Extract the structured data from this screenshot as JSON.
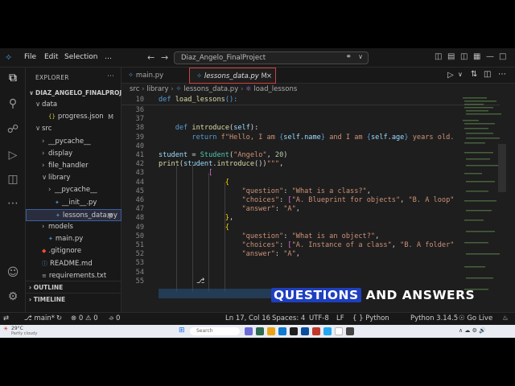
{
  "window": {
    "menus": [
      "File",
      "Edit",
      "Selection",
      "…"
    ],
    "search_text": "Diaz_Angelo_FinalProject"
  },
  "sidebar": {
    "title": "EXPLORER",
    "root": "DIAZ_ANGELO_FINALPROJ...",
    "items": [
      {
        "label": "data",
        "chev": "∨",
        "indent": 1,
        "icon": "folder-icon"
      },
      {
        "label": "progress.json",
        "badge": "M",
        "indent": 2,
        "icon": "json-icon"
      },
      {
        "label": "src",
        "chev": "∨",
        "indent": 1,
        "icon": "folder-icon"
      },
      {
        "label": "__pycache__",
        "chev": "›",
        "indent": 2,
        "icon": "folder-icon"
      },
      {
        "label": "display",
        "chev": "›",
        "indent": 2,
        "icon": "folder-icon"
      },
      {
        "label": "file_handler",
        "chev": "›",
        "indent": 2,
        "icon": "folder-icon"
      },
      {
        "label": "library",
        "chev": "∨",
        "indent": 2,
        "icon": "folder-icon"
      },
      {
        "label": "__pycache__",
        "chev": "›",
        "indent": 3,
        "icon": "folder-icon"
      },
      {
        "label": "__init__.py",
        "indent": 3,
        "icon": "python-icon"
      },
      {
        "label": "lessons_data.py",
        "badge": "M",
        "indent": 3,
        "icon": "python-icon",
        "selected": true
      },
      {
        "label": "models",
        "chev": "›",
        "indent": 2,
        "icon": "folder-icon"
      },
      {
        "label": "main.py",
        "indent": 2,
        "icon": "python-icon"
      },
      {
        "label": ".gitignore",
        "indent": 1,
        "icon": "git-icon"
      },
      {
        "label": "README.md",
        "indent": 1,
        "icon": "info-icon"
      },
      {
        "label": "requirements.txt",
        "indent": 1,
        "icon": "text-file-icon"
      }
    ],
    "outline": "OUTLINE",
    "timeline": "TIMELINE"
  },
  "tabs": [
    {
      "label": "main.py",
      "active": false
    },
    {
      "label": "lessons_data.py",
      "badge": "M",
      "active": true
    }
  ],
  "breadcrumb": [
    "src",
    "library",
    "lessons_data.py",
    "load_lessons"
  ],
  "code": {
    "sticky": {
      "num": "10",
      "text": "def load_lessons():"
    },
    "lines": [
      {
        "num": "36",
        "html": ""
      },
      {
        "num": "37",
        "html": ""
      },
      {
        "num": "38",
        "html": "    <span class='k'>def</span> <span class='f'>introduce</span>(<span class='v'>self</span>):"
      },
      {
        "num": "39",
        "html": "        <span class='k'>return</span> <span class='s'>f\"Hello, I am </span><span class='k'>{</span><span class='v'>self.name</span><span class='k'>}</span><span class='s'> and I am </span><span class='k'>{</span><span class='v'>self.age</span><span class='k'>}</span><span class='s'> years old.</span>"
      },
      {
        "num": "40",
        "html": ""
      },
      {
        "num": "41",
        "html": "<span class='v'>student</span> = <span class='c'>Student</span>(<span class='s'>\"Angelo\"</span>, <span class='n'>20</span>)"
      },
      {
        "num": "42",
        "html": "<span class='f'>print</span>(<span class='v'>student</span>.<span class='f'>introduce</span>())<span class='s'>\"\"\"</span>,"
      },
      {
        "num": "43",
        "html": "            <span class='br'>[</span>"
      },
      {
        "num": "44",
        "html": "                <span class='b'>{</span>"
      },
      {
        "num": "45",
        "html": "                    <span class='s'>\"question\"</span>: <span class='s'>\"What is a class?\"</span>,"
      },
      {
        "num": "46",
        "html": "                    <span class='s'>\"choices\"</span>: <span class='br'>[</span><span class='s'>\"A. Blueprint for objects\"</span>, <span class='s'>\"B. A loop\"</span>"
      },
      {
        "num": "47",
        "html": "                    <span class='s'>\"answer\"</span>: <span class='s'>\"A\"</span>,"
      },
      {
        "num": "48",
        "html": "                <span class='b'>}</span>,"
      },
      {
        "num": "49",
        "html": "                <span class='b'>{</span>"
      },
      {
        "num": "50",
        "html": "                    <span class='s'>\"question\"</span>: <span class='s'>\"What is an object?\"</span>,"
      },
      {
        "num": "51",
        "html": "                    <span class='s'>\"choices\"</span>: <span class='br'>[</span><span class='s'>\"A. Instance of a class\"</span>, <span class='s'>\"B. A folder\"</span>"
      },
      {
        "num": "52",
        "html": "                    <span class='s'>\"answer\"</span>: <span class='s'>\"A\"</span>,"
      },
      {
        "num": "53",
        "html": ""
      },
      {
        "num": "54",
        "html": ""
      },
      {
        "num": "55",
        "html": ""
      }
    ]
  },
  "caption": {
    "highlight": "QUESTIONS",
    "rest": "AND ANSWERS"
  },
  "statusbar": {
    "branch": "main*",
    "errors": "0",
    "warnings": "0",
    "position": "Ln 17, Col 16",
    "spaces": "Spaces: 4",
    "encoding": "UTF-8",
    "eol": "LF",
    "language": "Python",
    "interpreter": "Python 3.14.5",
    "golive": "Go Live"
  },
  "taskbar": {
    "weather_temp": "29°C",
    "weather_desc": "Partly cloudy",
    "search": "Search"
  }
}
